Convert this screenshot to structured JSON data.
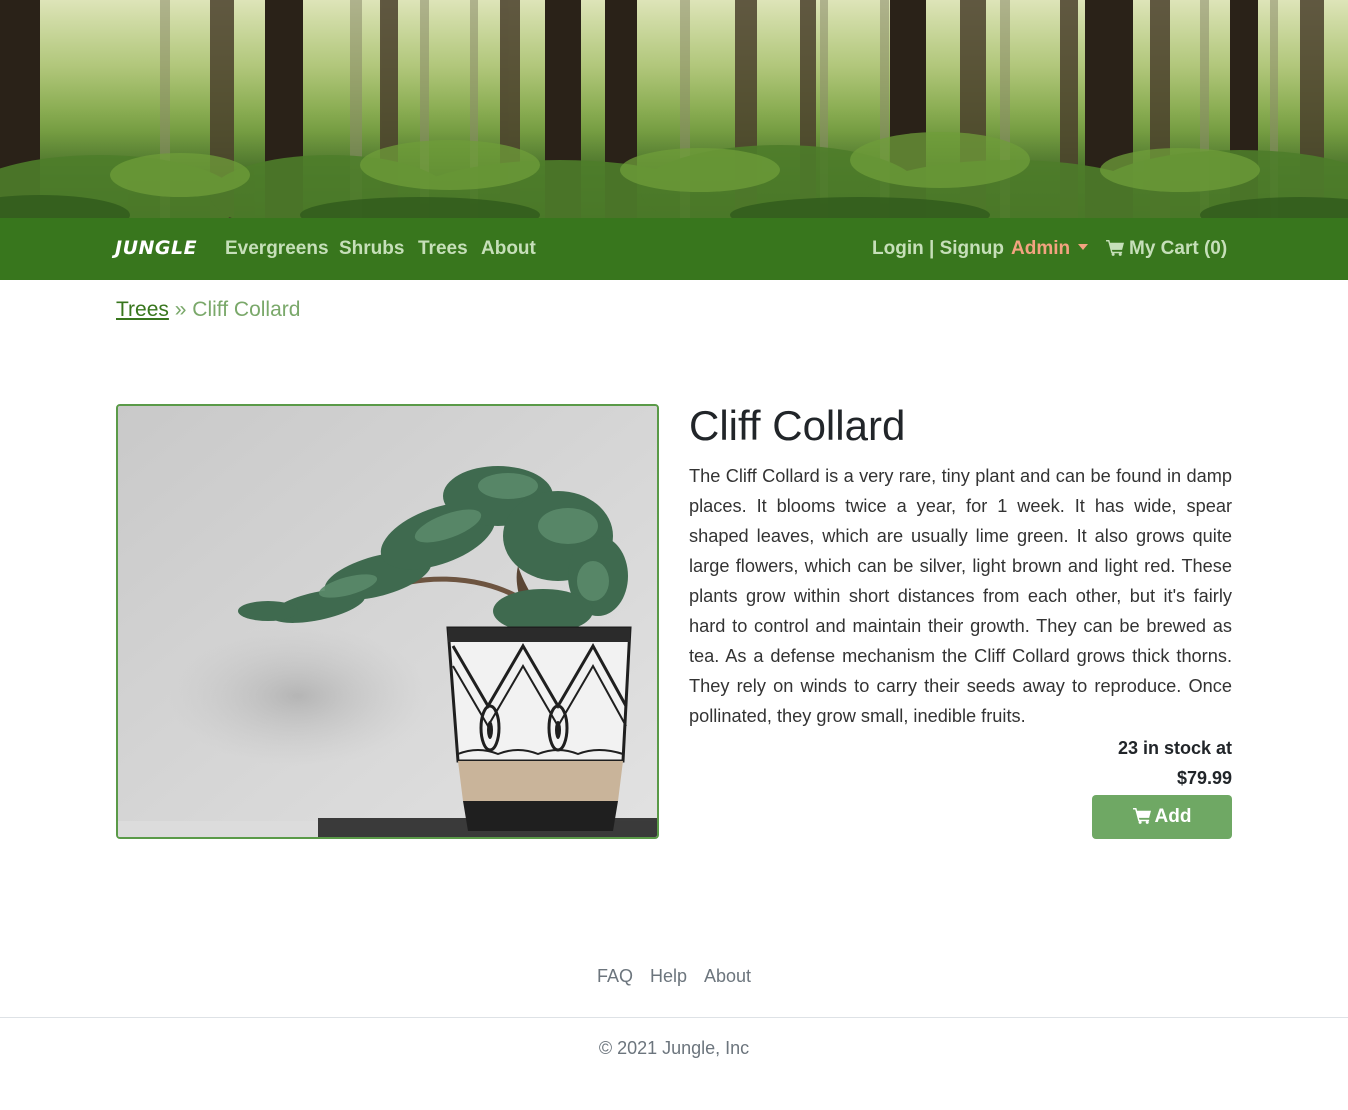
{
  "nav": {
    "brand": "JUNGLE",
    "links": [
      "Evergreens",
      "Shrubs",
      "Trees",
      "About"
    ],
    "login_signup": "Login | Signup",
    "admin": "Admin",
    "cart": "My Cart (0)"
  },
  "breadcrumb": {
    "parent": "Trees",
    "separator": "»",
    "current": "Cliff Collard"
  },
  "product": {
    "name": "Cliff Collard",
    "description": "The Cliff Collard is a very rare, tiny plant and can be found in damp places. It blooms twice a year, for 1 week. It has wide, spear shaped leaves, which are usually lime green. It also grows quite large flowers, which can be silver, light brown and light red. These plants grow within short distances from each other, but it's fairly hard to control and maintain their growth. They can be brewed as tea. As a defense mechanism the Cliff Collard grows thick thorns. They rely on winds to carry their seeds away to reproduce. Once pollinated, they grow small, inedible fruits.",
    "stock_text": "23 in stock at",
    "price": "$79.99",
    "add_label": "Add"
  },
  "footer": {
    "links": [
      "FAQ",
      "Help",
      "About"
    ],
    "copyright": "© 2021 Jungle, Inc"
  },
  "icons": {
    "cart": "cart-icon",
    "caret": "chevron-down-icon"
  },
  "colors": {
    "navbar": "#38761d",
    "nav_link": "#c6dfb9",
    "admin": "#f3a380",
    "add_button": "#6fa864",
    "breadcrumb_link": "#38761d"
  }
}
